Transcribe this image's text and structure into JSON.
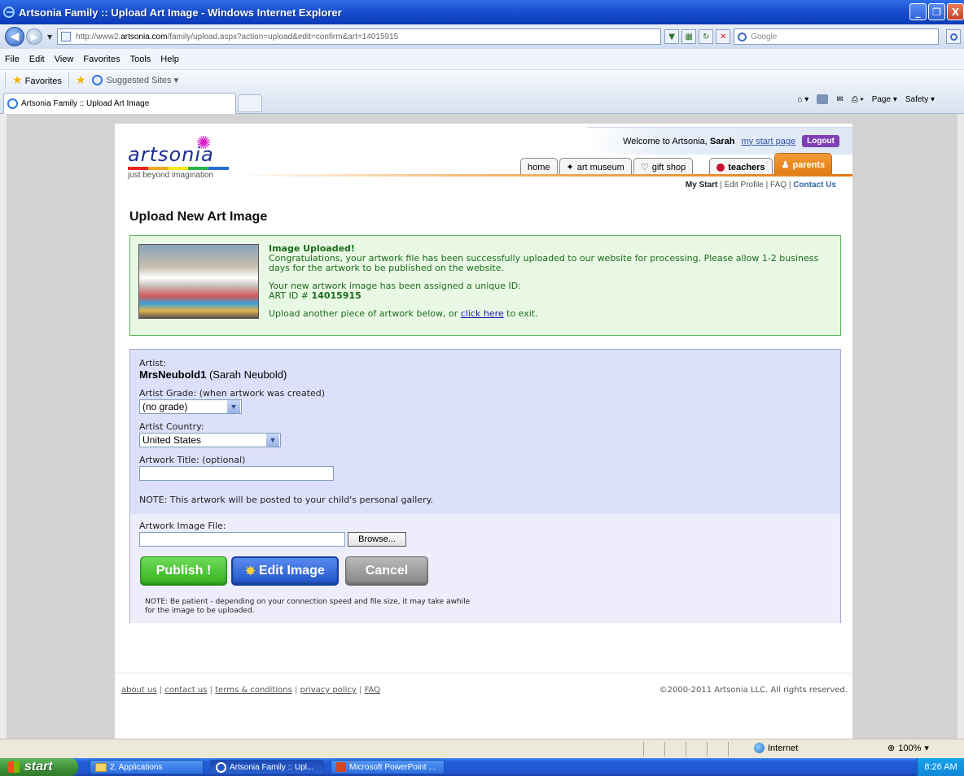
{
  "window": {
    "title": "Artsonia Family :: Upload Art Image - Windows Internet Explorer",
    "min": "_",
    "max": "❐",
    "close": "X"
  },
  "address": {
    "url_prefix": "http://www2.",
    "url_domain": "artsonia.com",
    "url_suffix": "/family/upload.aspx?action=upload&edit=confirm&art=14015915",
    "search_placeholder": "Google"
  },
  "menu": [
    "File",
    "Edit",
    "View",
    "Favorites",
    "Tools",
    "Help"
  ],
  "favorites": {
    "label": "Favorites",
    "suggested": "Suggested Sites ▾"
  },
  "tab": {
    "title": "Artsonia Family :: Upload Art Image"
  },
  "command_bar": {
    "page": "Page ▾",
    "safety": "Safety ▾"
  },
  "site": {
    "logo_text": "artsonia",
    "tagline": "just beyond imagination",
    "logo_colors": [
      "#e8251f",
      "#f5a623",
      "#f8e71c",
      "#2bb24c",
      "#2a6fd6"
    ],
    "welcome_prefix": "Welcome to Artsonia,",
    "welcome_name": "Sarah",
    "my_start_page": "my start page",
    "logout": "Logout",
    "nav": {
      "home": "home",
      "art_museum": "art museum",
      "gift_shop": "gift shop",
      "teachers": "teachers",
      "parents": "parents"
    },
    "subnav": {
      "my_start": "My Start",
      "sep1": " | ",
      "edit_profile": "Edit Profile",
      "sep2": " | ",
      "faq": "FAQ",
      "sep3": " | ",
      "contact_us": "Contact Us"
    }
  },
  "page": {
    "title": "Upload New Art Image",
    "success": {
      "heading": "Image Uploaded!",
      "body": "Congratulations, your artwork file has been successfully uploaded to our website for processing. Please allow 1-2 business days for the artwork to be published on the website.",
      "id_intro": "Your new artwork image has been assigned a unique ID:",
      "id_label": "ART ID #",
      "id_value": "14015915",
      "exit_prefix": "Upload another piece of artwork below, or",
      "exit_link": "click here",
      "exit_suffix": "to exit."
    },
    "form": {
      "artist_label": "Artist:",
      "artist_username": "MrsNeubold1",
      "artist_fullname": "(Sarah Neubold)",
      "grade_label": "Artist Grade: (when artwork was created)",
      "grade_value": "(no grade)",
      "country_label": "Artist Country:",
      "country_value": "United States",
      "title_label": "Artwork Title: (optional)",
      "title_value": "",
      "note": "NOTE: This artwork will be posted to your child's personal gallery.",
      "file_label": "Artwork Image File:",
      "file_value": "",
      "browse": "Browse...",
      "publish": "Publish !",
      "edit_image": "Edit Image",
      "cancel": "Cancel",
      "patience_note": "NOTE: Be patient - depending on your connection speed and file size, it may take awhile for the image to be uploaded."
    },
    "footer": {
      "links": [
        "about us",
        "contact us",
        "terms & conditions",
        "privacy policy",
        "FAQ"
      ],
      "copyright": "©2000-2011 Artsonia LLC. All rights reserved."
    }
  },
  "statusbar": {
    "zone": "Internet",
    "zoom": "100%"
  },
  "taskbar": {
    "start": "start",
    "items": [
      "2. Applications",
      "Artsonia Family :: Upl...",
      "Microsoft PowerPoint ..."
    ],
    "clock": "8:26 AM"
  }
}
